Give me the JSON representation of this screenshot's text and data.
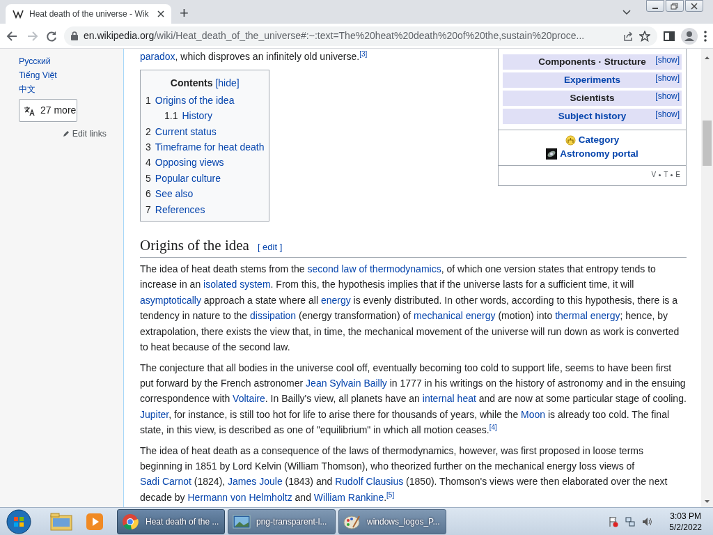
{
  "browser": {
    "tabs": [
      {
        "title": "Heat death of the universe - Wik",
        "selected": true
      }
    ],
    "new_tab": "+",
    "address_host": "en.wikipedia.org",
    "address_path": "/wiki/Heat_death_of_the_universe#:~:text=The%20heat%20death%20of%20the,sustain%20proce..."
  },
  "sidebar": {
    "languages": [
      "Русский",
      "Tiếng Việt",
      "中文"
    ],
    "more_button": "27 more",
    "edit_links": "Edit links"
  },
  "intro_tail": [
    {
      "kind": "link",
      "text": "paradox"
    },
    {
      "kind": "text",
      "text": ", which disproves an infinitely old universe."
    },
    {
      "kind": "ref",
      "text": "[3]"
    }
  ],
  "contents": {
    "title": "Contents",
    "toggle": "[hide]",
    "items": [
      {
        "number": "1",
        "label": "Origins of the idea",
        "children": [
          {
            "number": "1.1",
            "label": "History"
          }
        ]
      },
      {
        "number": "2",
        "label": "Current status"
      },
      {
        "number": "3",
        "label": "Timeframe for heat death"
      },
      {
        "number": "4",
        "label": "Opposing views"
      },
      {
        "number": "5",
        "label": "Popular culture"
      },
      {
        "number": "6",
        "label": "See also"
      },
      {
        "number": "7",
        "label": "References"
      }
    ]
  },
  "navbox": {
    "groups": [
      {
        "title": "Components · Structure",
        "kind": "text",
        "toggle": "[show]"
      },
      {
        "title": "Experiments",
        "kind": "link",
        "toggle": "[show]"
      },
      {
        "title": "Scientists",
        "kind": "text",
        "toggle": "[show]"
      },
      {
        "title": "Subject history",
        "kind": "link",
        "toggle": "[show]"
      }
    ],
    "category": "Category",
    "portal": "Astronomy portal",
    "vte": [
      "V",
      "T",
      "E"
    ]
  },
  "section": {
    "heading": "Origins of the idea",
    "edit": "[ edit ]",
    "paragraphs": [
      [
        {
          "kind": "text",
          "text": "The idea of heat death stems from the "
        },
        {
          "kind": "link",
          "text": "second law of thermodynamics"
        },
        {
          "kind": "text",
          "text": ", of which one version states that entropy tends to increase in an "
        },
        {
          "kind": "link",
          "text": "isolated system"
        },
        {
          "kind": "text",
          "text": ". From this, the hypothesis implies that if the universe lasts for a sufficient time, it will "
        },
        {
          "kind": "link",
          "text": "asymptotically"
        },
        {
          "kind": "text",
          "text": " approach a state where all "
        },
        {
          "kind": "link",
          "text": "energy"
        },
        {
          "kind": "text",
          "text": " is evenly distributed. In other words, according to this hypothesis, there is a tendency in nature to the "
        },
        {
          "kind": "link",
          "text": "dissipation"
        },
        {
          "kind": "text",
          "text": " (energy transformation) of "
        },
        {
          "kind": "link",
          "text": "mechanical energy"
        },
        {
          "kind": "text",
          "text": " (motion) into "
        },
        {
          "kind": "link",
          "text": "thermal energy"
        },
        {
          "kind": "text",
          "text": "; hence, by extrapolation, there exists the view that, in time, the mechanical movement of the universe will run down as work is converted to heat because of the second law."
        }
      ],
      [
        {
          "kind": "text",
          "text": "The conjecture that all bodies in the universe cool off, eventually becoming too cold to support life, seems to have been first put forward by the French astronomer "
        },
        {
          "kind": "link",
          "text": "Jean Sylvain Bailly"
        },
        {
          "kind": "text",
          "text": " in 1777 in his writings on the history of astronomy and in the ensuing correspondence with "
        },
        {
          "kind": "link",
          "text": "Voltaire"
        },
        {
          "kind": "text",
          "text": ". In Bailly's view, all planets have an "
        },
        {
          "kind": "link",
          "text": "internal heat"
        },
        {
          "kind": "text",
          "text": " and are now at some particular stage of cooling. "
        },
        {
          "kind": "link",
          "text": "Jupiter"
        },
        {
          "kind": "text",
          "text": ", for instance, is still too hot for life to arise there for thousands of years, while the "
        },
        {
          "kind": "link",
          "text": "Moon"
        },
        {
          "kind": "text",
          "text": " is already too cold. The final state, in this view, is described as one of \"equilibrium\" in which all motion ceases."
        },
        {
          "kind": "ref",
          "text": "[4]"
        }
      ],
      [
        {
          "kind": "text",
          "text": "The idea of heat death as a consequence of the laws of thermodynamics, however, was first proposed in loose terms beginning in 1851 by Lord Kelvin (William Thomson), who theorized further on the mechanical energy loss views of "
        },
        {
          "kind": "link",
          "text": "Sadi Carnot"
        },
        {
          "kind": "text",
          "text": " (1824), "
        },
        {
          "kind": "link",
          "text": "James Joule"
        },
        {
          "kind": "text",
          "text": " (1843) and "
        },
        {
          "kind": "link",
          "text": "Rudolf Clausius"
        },
        {
          "kind": "text",
          "text": " (1850). Thomson's views were then elaborated over the next decade by "
        },
        {
          "kind": "link",
          "text": "Hermann von Helmholtz"
        },
        {
          "kind": "text",
          "text": " and "
        },
        {
          "kind": "link",
          "text": "William Rankine"
        },
        {
          "kind": "text",
          "text": "."
        },
        {
          "kind": "ref",
          "text": "[5]"
        }
      ]
    ]
  },
  "taskbar": {
    "windows": [
      {
        "kind": "chrome",
        "title": "Heat death of the ...",
        "selected": true
      },
      {
        "kind": "viewer",
        "title": "png-transparent-l...",
        "selected": false
      },
      {
        "kind": "paint",
        "title": "windows_logos_P...",
        "selected": false
      }
    ],
    "time": "3:03 PM",
    "date": "5/2/2022"
  }
}
